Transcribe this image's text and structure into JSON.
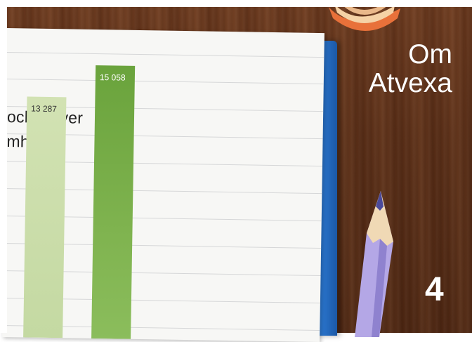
{
  "section": {
    "title_line1": "Om",
    "title_line2": "Atvexa"
  },
  "page_number": "4",
  "notebook": {
    "heading_line1": "och elever",
    "heading_line2": "mheter"
  },
  "chart_data": {
    "type": "bar",
    "values": [
      13287,
      15058
    ],
    "value_labels": [
      "13 287",
      "15 058"
    ],
    "colors": [
      "#c8dca8",
      "#72aa45"
    ]
  },
  "colors": {
    "wood": "#5a2f18",
    "notebook_blue": "#2c78d1",
    "paper": "#f7f7f5",
    "text_white": "#ffffff"
  }
}
